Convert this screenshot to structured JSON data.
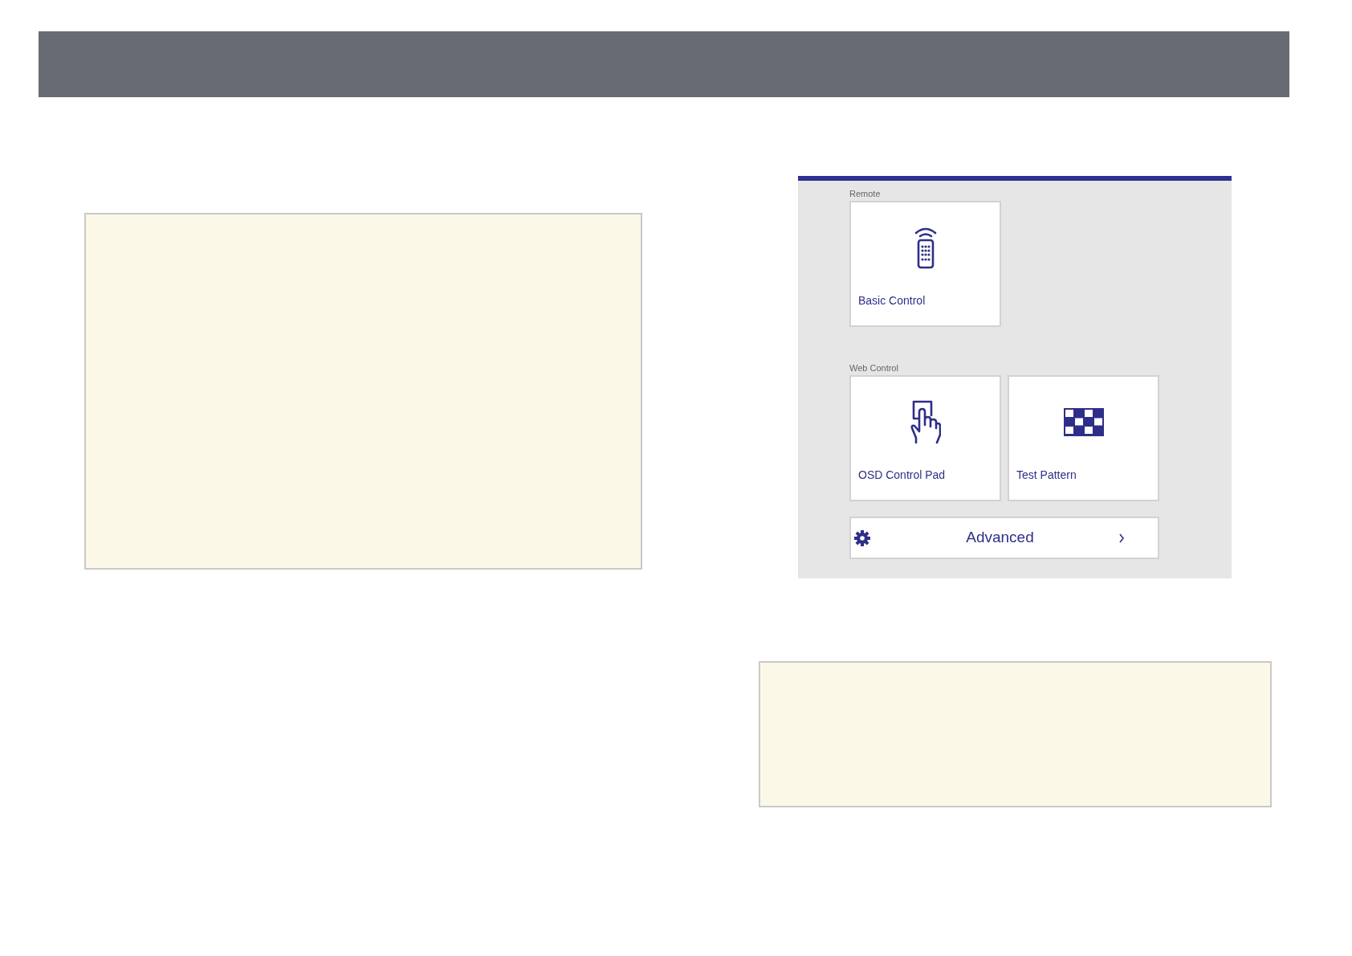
{
  "web_remote_screen": {
    "sections": [
      {
        "label": "Remote",
        "tiles": [
          {
            "kind": "remote",
            "label": "Basic Control"
          }
        ]
      },
      {
        "label": "Web Control",
        "tiles": [
          {
            "kind": "hand",
            "label": "OSD Control Pad"
          },
          {
            "kind": "pattern",
            "label": "Test Pattern"
          }
        ]
      }
    ],
    "advanced_row": {
      "label": "Advanced"
    }
  }
}
